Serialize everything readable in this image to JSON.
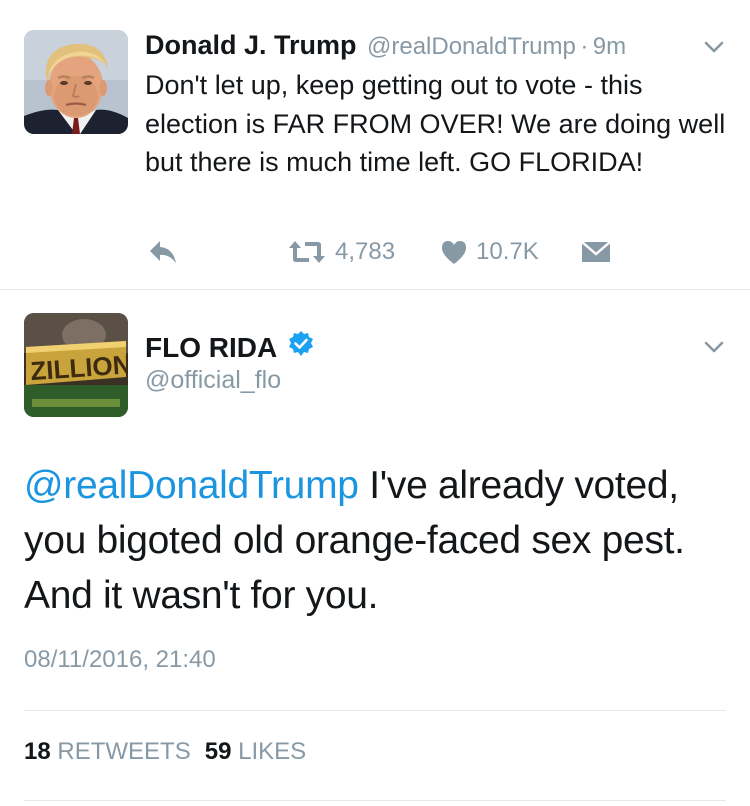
{
  "tweet1": {
    "author_name": "Donald J. Trump",
    "handle": "@realDonaldTrump",
    "separator": "·",
    "time": "9m",
    "text": "Don't let up, keep getting out to vote - this election is FAR FROM OVER! We are doing well but there is much time left. GO FLORIDA!",
    "retweet_count": "4,783",
    "like_count": "10.7K",
    "icons": [
      "reply-icon",
      "retweet-icon",
      "like-icon",
      "direct-message-icon",
      "chevron-down-icon"
    ]
  },
  "tweet2": {
    "author_name": "FLO RIDA",
    "handle": "@official_flo",
    "mention": "@realDonaldTrump",
    "text": " I've already voted, you bigoted old orange-faced sex pest. And it wasn't for you.",
    "timestamp": "08/11/2016, 21:40",
    "retweets_count": "18",
    "retweets_label": "RETWEETS",
    "likes_count": "59",
    "likes_label": "LIKES",
    "icons": [
      "verified-badge-icon",
      "chevron-down-icon"
    ],
    "avatar_text": "ZILLIONAI"
  },
  "colors": {
    "text": "#14171a",
    "secondary": "#8899a6",
    "link": "#1b95e0",
    "verified": "#1da1f2",
    "divider": "#e1e8ed"
  }
}
